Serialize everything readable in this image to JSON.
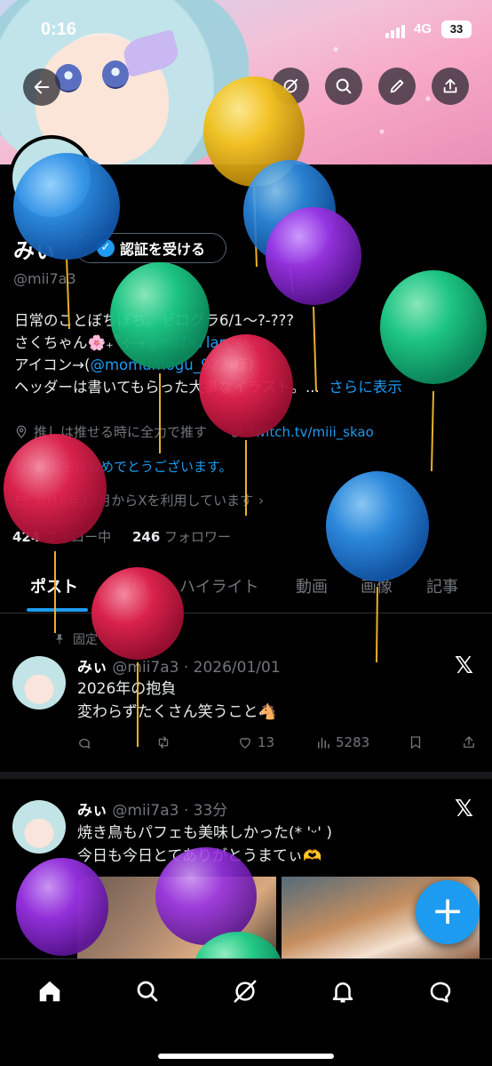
{
  "status_bar": {
    "time": "0:16",
    "network": "4G",
    "battery": "33"
  },
  "profile": {
    "name": "みぃ",
    "verify_button": "認証を受ける",
    "handle": "@mii7a3",
    "bio_line1": "日常のことぼちぼち。ゼログラ6/1～?-???",
    "bio_line2_prefix": "さくちゃん🌸₊˚⊹→",
    "bio_line2_link": "@mi7a7lan_skao",
    "bio_line3_prefix": " アイコン→(",
    "bio_line3_link": "@momumogu_923",
    "bio_line3_suffix": " 様)",
    "bio_line4": "ヘッダーは書いてもらった大事なイラスト。...",
    "see_more": "さらに表示",
    "location": "推しは推せる時に全力で推す",
    "website": "twitch.tv/miii_skao",
    "birthday": "お誕生日おめでとうございます。",
    "joined": "2016年12月からXを利用しています",
    "following_count": "424",
    "following_label": "フォロー中",
    "followers_count": "246",
    "followers_label": "フォロワー"
  },
  "tabs": [
    "ポスト",
    "返信",
    "ハイライト",
    "動画",
    "画像",
    "記事"
  ],
  "pinned_label": "固定",
  "tweets": [
    {
      "name": "みぃ",
      "handle_date": "@mii7a3 · 2026/01/01",
      "line1": "2026年の抱負",
      "line2": "変わらずたくさん笑うこと🐴",
      "likes": "13",
      "views": "5283"
    },
    {
      "name": "みぃ",
      "handle_date": "@mii7a3 · 33分",
      "line1": "焼き鳥もパフェも美味しかった(* 'ᵕ' )",
      "line2": "今日も今日とてありがとうまてぃ🫶"
    }
  ],
  "fab_label": "+",
  "colors": {
    "accent": "#1d9bf0",
    "background": "#000000",
    "muted": "#71767b"
  }
}
